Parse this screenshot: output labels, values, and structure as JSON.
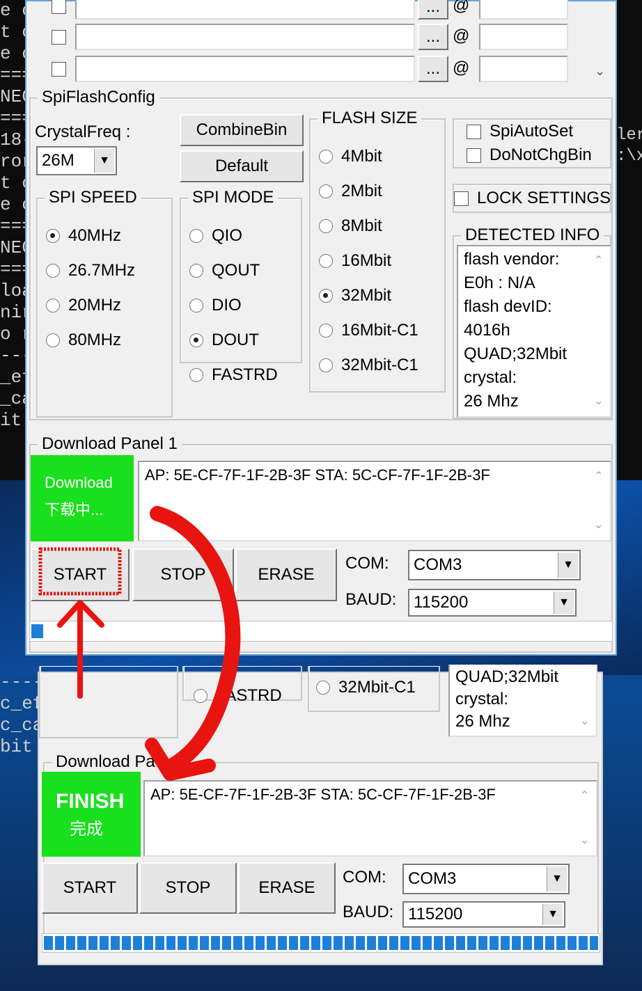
{
  "console_left": [
    "e c",
    "t c",
    "e c",
    "===",
    "NEC",
    "===",
    "18-",
    "ror",
    "t c",
    "e c",
    "===",
    "NEC",
    "===",
    "loa",
    "nir",
    "o r",
    "---",
    "_ef",
    "_ca",
    "it "
  ],
  "console_left2": [
    "----",
    "c_ef",
    "c_ca",
    "bit "
  ],
  "console_right": [
    "ler",
    ":\\x"
  ],
  "top_rows": {
    "browse_label": "...",
    "at_label": "@"
  },
  "spi_flash_config": {
    "title": "SpiFlashConfig",
    "crystal_label": "CrystalFreq :",
    "crystal_value": "26M",
    "combine_bin": "CombineBin",
    "default_btn": "Default",
    "flash_size_title": "FLASH SIZE",
    "flash_sizes": [
      "4Mbit",
      "2Mbit",
      "8Mbit",
      "16Mbit",
      "32Mbit",
      "16Mbit-C1",
      "32Mbit-C1"
    ],
    "flash_selected": "32Mbit",
    "spi_auto_set": "SpiAutoSet",
    "do_not_chg_bin": "DoNotChgBin",
    "lock_settings": "LOCK SETTINGS",
    "spi_speed_title": "SPI SPEED",
    "spi_speeds": [
      "40MHz",
      "26.7MHz",
      "20MHz",
      "80MHz"
    ],
    "speed_selected": "40MHz",
    "spi_mode_title": "SPI MODE",
    "spi_modes": [
      "QIO",
      "QOUT",
      "DIO",
      "DOUT",
      "FASTRD"
    ],
    "mode_selected": "DOUT",
    "detected_title": "DETECTED INFO",
    "detected_lines": [
      "flash vendor:",
      "E0h : N/A",
      "flash devID:",
      "4016h",
      "QUAD;32Mbit",
      "crystal:",
      "26 Mhz"
    ]
  },
  "download_panel": {
    "title": "Download Panel 1",
    "status_en": "Download",
    "status_cn": "下载中...",
    "mac_info": "AP:  5E-CF-7F-1F-2B-3F  STA:  5C-CF-7F-1F-2B-3F",
    "start": "START",
    "stop": "STOP",
    "erase": "ERASE",
    "com_label": "COM:",
    "com_value": "COM3",
    "baud_label": "BAUD:",
    "baud_value": "115200",
    "progress": 0.02
  },
  "second_window": {
    "flash_item": "32Mbit-C1",
    "mode_item": "FASTRD",
    "detected_lines": [
      "QUAD;32Mbit",
      "crystal:",
      "26 Mhz"
    ],
    "panel_title": "Download Pa",
    "status_en": "FINISH",
    "status_cn": "完成",
    "mac_info": "AP:  5E-CF-7F-1F-2B-3F  STA:  5C-CF-7F-1F-2B-3F",
    "start": "START",
    "stop": "STOP",
    "erase": "ERASE",
    "com_label": "COM:",
    "com_value": "COM3",
    "baud_label": "BAUD:",
    "baud_value": "115200",
    "progress": 1.0
  },
  "colors": {
    "green": "#19e01c",
    "progress_blue": "#1e7fd8",
    "annotation_red": "#e8140f"
  }
}
